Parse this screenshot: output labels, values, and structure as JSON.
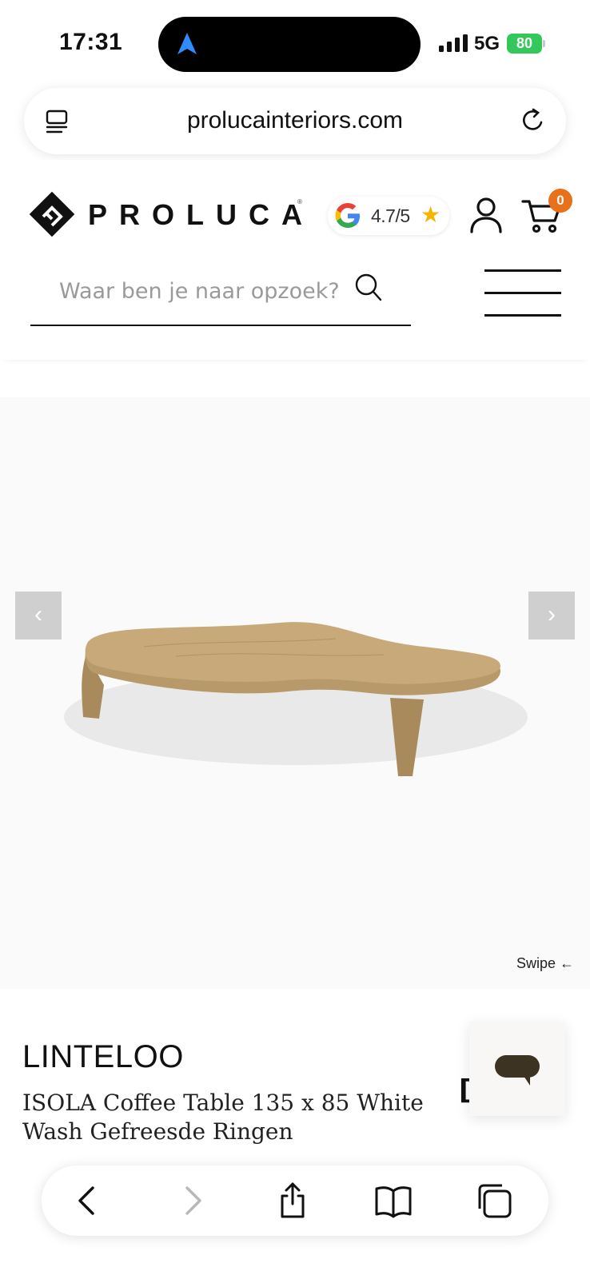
{
  "status_bar": {
    "time": "17:31",
    "network": "5G",
    "battery": "80"
  },
  "browser": {
    "url": "prolucainteriors.com"
  },
  "header": {
    "logo_text": "PROLUCA",
    "logo_registered": "®",
    "rating": "4.7/5",
    "cart_count": "0",
    "search_placeholder": "Waar ben je naar opzoek?"
  },
  "gallery": {
    "prev_label": "‹",
    "next_label": "›",
    "swipe_hint": "Swipe ←"
  },
  "product": {
    "brand": "LINTELOO",
    "title": "ISOLA Coffee Table 135 x 85 White Wash Gefreesde Ringen",
    "partial_char": "[",
    "wood_color": "#c7a97a"
  },
  "colors": {
    "accent": "#e8711c",
    "battery": "#34c759",
    "chat_bubble": "#3d3322"
  }
}
